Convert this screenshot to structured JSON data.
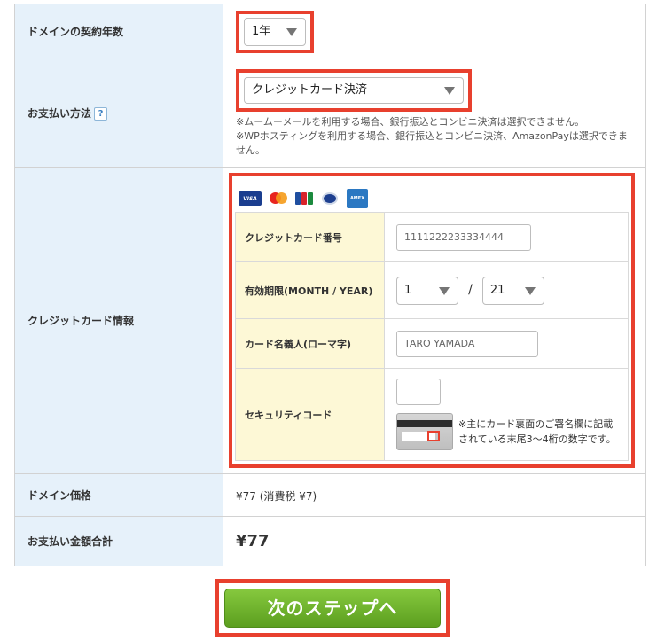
{
  "colors": {
    "highlight": "#e8402e",
    "label_bg": "#e6f1fa",
    "card_label_bg": "#fdf8d6",
    "button_green": "#6fb22d"
  },
  "rows": {
    "term": {
      "label": "ドメインの契約年数",
      "value": "1年"
    },
    "payment": {
      "label": "お支払い方法",
      "help_icon": "?",
      "value": "クレジットカード決済",
      "note1": "※ムームーメールを利用する場合、銀行振込とコンビニ決済は選択できません。",
      "note2": "※WPホスティングを利用する場合、銀行振込とコンビニ決済、AmazonPayは選択できません。"
    },
    "card": {
      "label": "クレジットカード情報",
      "brands": [
        "visa",
        "mastercard",
        "jcb",
        "diners",
        "amex"
      ],
      "number_label": "クレジットカード番号",
      "number_value": "1111222233334444",
      "expiry_label": "有効期限(MONTH / YEAR)",
      "expiry_month": "1",
      "expiry_sep": "/",
      "expiry_year": "21",
      "name_label": "カード名義人(ローマ字)",
      "name_value": "TARO YAMADA",
      "security_label": "セキュリティコード",
      "security_value": "",
      "security_note1": "※主にカード裏面のご署名欄に記載",
      "security_note2": "されている末尾3〜4桁の数字です。"
    },
    "domain_price": {
      "label": "ドメイン価格",
      "value": "¥77 (消費税 ¥7)"
    },
    "total": {
      "label": "お支払い金額合計",
      "value": "¥77"
    }
  },
  "next_button": {
    "label": "次のステップへ"
  }
}
